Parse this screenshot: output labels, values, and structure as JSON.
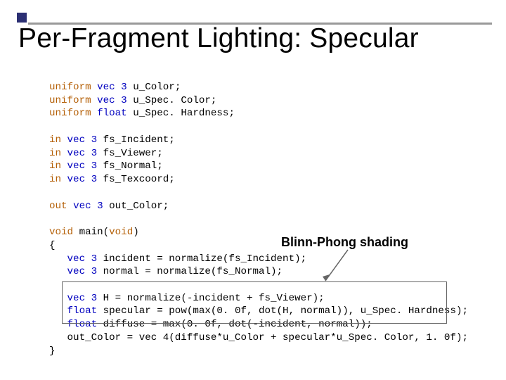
{
  "title": "Per-Fragment Lighting:  Specular",
  "callout": {
    "label": "Blinn-Phong shading"
  },
  "kw": {
    "uniform": "uniform",
    "in": "in",
    "out": "out",
    "void": "void",
    "vec3": "vec 3",
    "float": "float"
  },
  "punct": {
    "brace_open": "{",
    "brace_close": "}"
  },
  "decl": {
    "u_Color": " u_Color;",
    "u_SpecColor": " u_Spec. Color;",
    "u_SpecHardness": " u_Spec. Hardness;",
    "fs_Incident": " fs_Incident;",
    "fs_Viewer": " fs_Viewer;",
    "fs_Normal": " fs_Normal;",
    "fs_Texcoord": " fs_Texcoord;",
    "out_Color": " out_Color;",
    "main": " main("
  },
  "body": {
    "l0": " incident = normalize(fs_Incident);",
    "l1": " normal = normalize(fs_Normal);",
    "l2": " H = normalize(-incident + fs_Viewer);",
    "l3": " specular = pow(max(0. 0f, dot(H, normal)), u_Spec. Hardness);",
    "l4": " diffuse = max(0. 0f, dot(-incident, normal));",
    "l5": "   out_Color = vec 4(diffuse*u_Color + specular*u_Spec. Color, 1. 0f);"
  }
}
